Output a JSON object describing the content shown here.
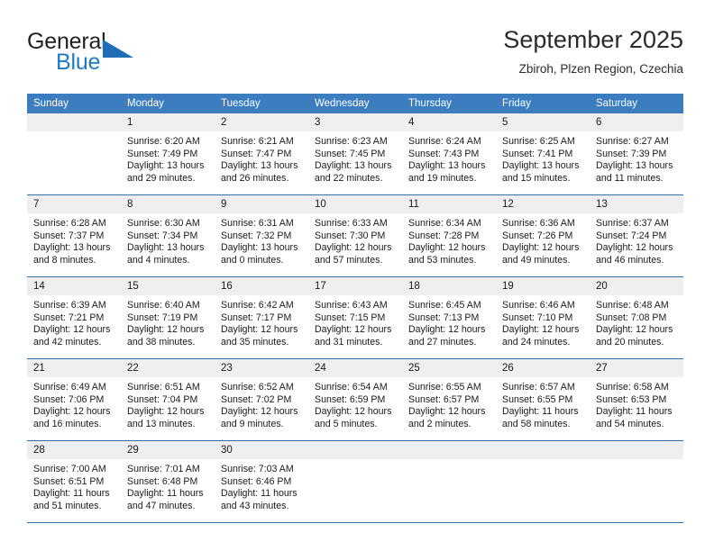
{
  "brand": {
    "line1": "General",
    "line2": "Blue",
    "logo_icon": "triangle-flag-icon",
    "accent_color": "#1f6db5"
  },
  "header": {
    "title": "September 2025",
    "subtitle": "Zbiroh, Plzen Region, Czechia"
  },
  "theme": {
    "header_row_bg": "#3b7dbf",
    "date_band_bg": "#efefef",
    "row_divider": "#2f6fad",
    "text": "#1a1a1a"
  },
  "calendar": {
    "weekday_headers": [
      "Sunday",
      "Monday",
      "Tuesday",
      "Wednesday",
      "Thursday",
      "Friday",
      "Saturday"
    ],
    "weeks": [
      [
        {
          "date": "",
          "empty": true,
          "sunrise": "",
          "sunset": "",
          "daylight": ""
        },
        {
          "date": "1",
          "sunrise": "Sunrise: 6:20 AM",
          "sunset": "Sunset: 7:49 PM",
          "daylight": "Daylight: 13 hours and 29 minutes."
        },
        {
          "date": "2",
          "sunrise": "Sunrise: 6:21 AM",
          "sunset": "Sunset: 7:47 PM",
          "daylight": "Daylight: 13 hours and 26 minutes."
        },
        {
          "date": "3",
          "sunrise": "Sunrise: 6:23 AM",
          "sunset": "Sunset: 7:45 PM",
          "daylight": "Daylight: 13 hours and 22 minutes."
        },
        {
          "date": "4",
          "sunrise": "Sunrise: 6:24 AM",
          "sunset": "Sunset: 7:43 PM",
          "daylight": "Daylight: 13 hours and 19 minutes."
        },
        {
          "date": "5",
          "sunrise": "Sunrise: 6:25 AM",
          "sunset": "Sunset: 7:41 PM",
          "daylight": "Daylight: 13 hours and 15 minutes."
        },
        {
          "date": "6",
          "sunrise": "Sunrise: 6:27 AM",
          "sunset": "Sunset: 7:39 PM",
          "daylight": "Daylight: 13 hours and 11 minutes."
        }
      ],
      [
        {
          "date": "7",
          "sunrise": "Sunrise: 6:28 AM",
          "sunset": "Sunset: 7:37 PM",
          "daylight": "Daylight: 13 hours and 8 minutes."
        },
        {
          "date": "8",
          "sunrise": "Sunrise: 6:30 AM",
          "sunset": "Sunset: 7:34 PM",
          "daylight": "Daylight: 13 hours and 4 minutes."
        },
        {
          "date": "9",
          "sunrise": "Sunrise: 6:31 AM",
          "sunset": "Sunset: 7:32 PM",
          "daylight": "Daylight: 13 hours and 0 minutes."
        },
        {
          "date": "10",
          "sunrise": "Sunrise: 6:33 AM",
          "sunset": "Sunset: 7:30 PM",
          "daylight": "Daylight: 12 hours and 57 minutes."
        },
        {
          "date": "11",
          "sunrise": "Sunrise: 6:34 AM",
          "sunset": "Sunset: 7:28 PM",
          "daylight": "Daylight: 12 hours and 53 minutes."
        },
        {
          "date": "12",
          "sunrise": "Sunrise: 6:36 AM",
          "sunset": "Sunset: 7:26 PM",
          "daylight": "Daylight: 12 hours and 49 minutes."
        },
        {
          "date": "13",
          "sunrise": "Sunrise: 6:37 AM",
          "sunset": "Sunset: 7:24 PM",
          "daylight": "Daylight: 12 hours and 46 minutes."
        }
      ],
      [
        {
          "date": "14",
          "sunrise": "Sunrise: 6:39 AM",
          "sunset": "Sunset: 7:21 PM",
          "daylight": "Daylight: 12 hours and 42 minutes."
        },
        {
          "date": "15",
          "sunrise": "Sunrise: 6:40 AM",
          "sunset": "Sunset: 7:19 PM",
          "daylight": "Daylight: 12 hours and 38 minutes."
        },
        {
          "date": "16",
          "sunrise": "Sunrise: 6:42 AM",
          "sunset": "Sunset: 7:17 PM",
          "daylight": "Daylight: 12 hours and 35 minutes."
        },
        {
          "date": "17",
          "sunrise": "Sunrise: 6:43 AM",
          "sunset": "Sunset: 7:15 PM",
          "daylight": "Daylight: 12 hours and 31 minutes."
        },
        {
          "date": "18",
          "sunrise": "Sunrise: 6:45 AM",
          "sunset": "Sunset: 7:13 PM",
          "daylight": "Daylight: 12 hours and 27 minutes."
        },
        {
          "date": "19",
          "sunrise": "Sunrise: 6:46 AM",
          "sunset": "Sunset: 7:10 PM",
          "daylight": "Daylight: 12 hours and 24 minutes."
        },
        {
          "date": "20",
          "sunrise": "Sunrise: 6:48 AM",
          "sunset": "Sunset: 7:08 PM",
          "daylight": "Daylight: 12 hours and 20 minutes."
        }
      ],
      [
        {
          "date": "21",
          "sunrise": "Sunrise: 6:49 AM",
          "sunset": "Sunset: 7:06 PM",
          "daylight": "Daylight: 12 hours and 16 minutes."
        },
        {
          "date": "22",
          "sunrise": "Sunrise: 6:51 AM",
          "sunset": "Sunset: 7:04 PM",
          "daylight": "Daylight: 12 hours and 13 minutes."
        },
        {
          "date": "23",
          "sunrise": "Sunrise: 6:52 AM",
          "sunset": "Sunset: 7:02 PM",
          "daylight": "Daylight: 12 hours and 9 minutes."
        },
        {
          "date": "24",
          "sunrise": "Sunrise: 6:54 AM",
          "sunset": "Sunset: 6:59 PM",
          "daylight": "Daylight: 12 hours and 5 minutes."
        },
        {
          "date": "25",
          "sunrise": "Sunrise: 6:55 AM",
          "sunset": "Sunset: 6:57 PM",
          "daylight": "Daylight: 12 hours and 2 minutes."
        },
        {
          "date": "26",
          "sunrise": "Sunrise: 6:57 AM",
          "sunset": "Sunset: 6:55 PM",
          "daylight": "Daylight: 11 hours and 58 minutes."
        },
        {
          "date": "27",
          "sunrise": "Sunrise: 6:58 AM",
          "sunset": "Sunset: 6:53 PM",
          "daylight": "Daylight: 11 hours and 54 minutes."
        }
      ],
      [
        {
          "date": "28",
          "sunrise": "Sunrise: 7:00 AM",
          "sunset": "Sunset: 6:51 PM",
          "daylight": "Daylight: 11 hours and 51 minutes."
        },
        {
          "date": "29",
          "sunrise": "Sunrise: 7:01 AM",
          "sunset": "Sunset: 6:48 PM",
          "daylight": "Daylight: 11 hours and 47 minutes."
        },
        {
          "date": "30",
          "sunrise": "Sunrise: 7:03 AM",
          "sunset": "Sunset: 6:46 PM",
          "daylight": "Daylight: 11 hours and 43 minutes."
        },
        {
          "date": "",
          "empty": true,
          "sunrise": "",
          "sunset": "",
          "daylight": ""
        },
        {
          "date": "",
          "empty": true,
          "sunrise": "",
          "sunset": "",
          "daylight": ""
        },
        {
          "date": "",
          "empty": true,
          "sunrise": "",
          "sunset": "",
          "daylight": ""
        },
        {
          "date": "",
          "empty": true,
          "sunrise": "",
          "sunset": "",
          "daylight": ""
        }
      ]
    ]
  }
}
